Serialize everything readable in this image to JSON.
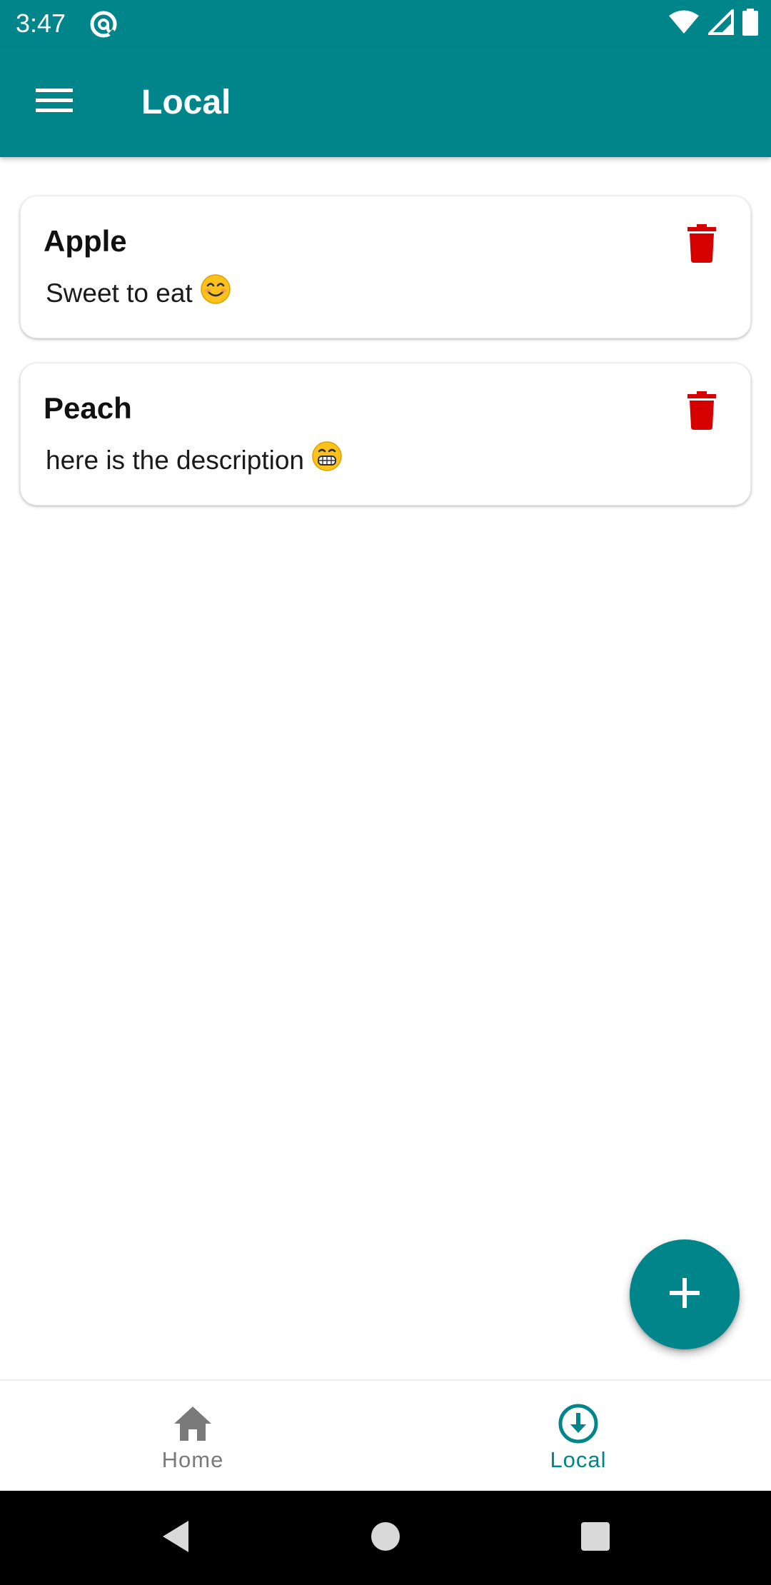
{
  "status_bar": {
    "time": "3:47",
    "icons": [
      "sync-icon",
      "wifi-icon",
      "cell-signal-icon",
      "battery-icon"
    ]
  },
  "app_bar": {
    "title": "Local",
    "menu_icon": "hamburger-menu-icon"
  },
  "items": [
    {
      "title": "Apple",
      "description": "Sweet to eat",
      "emoji": "smiling-face-icon",
      "delete_icon": "trash-icon"
    },
    {
      "title": "Peach",
      "description": "here is the description",
      "emoji": "grinning-face-icon",
      "delete_icon": "trash-icon"
    }
  ],
  "fab": {
    "icon": "plus-icon"
  },
  "bottom_nav": {
    "items": [
      {
        "label": "Home",
        "icon": "home-icon",
        "selected": false
      },
      {
        "label": "Local",
        "icon": "download-circle-icon",
        "selected": true
      }
    ]
  },
  "system_nav": {
    "icons": [
      "back-icon",
      "home-circle-icon",
      "recents-icon"
    ]
  },
  "colors": {
    "primary": "#00868a",
    "delete": "#d50000",
    "inactive": "#7a7a7a"
  }
}
